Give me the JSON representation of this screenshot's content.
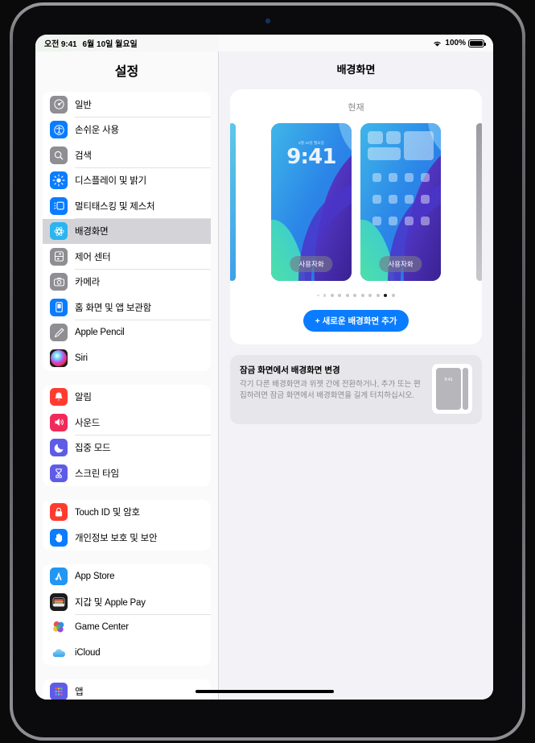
{
  "statusbar": {
    "time": "오전 9:41",
    "date": "6월 10일 월요일",
    "wifi_icon": "wifi-icon",
    "battery_pct": "100%",
    "battery_icon": "battery-icon"
  },
  "sidebar": {
    "title": "설정",
    "groups": [
      {
        "items": [
          {
            "label": "일반",
            "icon": "gear-icon",
            "color": "#8e8e93",
            "selected": false
          },
          {
            "label": "손쉬운 사용",
            "icon": "accessibility-icon",
            "color": "#0a7cff",
            "selected": false
          },
          {
            "label": "검색",
            "icon": "search-icon",
            "color": "#8e8e93",
            "selected": false
          },
          {
            "label": "디스플레이 및 밝기",
            "icon": "brightness-icon",
            "color": "#0a7cff",
            "selected": false
          },
          {
            "label": "멀티태스킹 및 제스처",
            "icon": "multitasking-icon",
            "color": "#0a7cff",
            "selected": false
          },
          {
            "label": "배경화면",
            "icon": "wallpaper-icon",
            "color": "#2bb5f0",
            "selected": true
          },
          {
            "label": "제어 센터",
            "icon": "control-center-icon",
            "color": "#8e8e93",
            "selected": false
          },
          {
            "label": "카메라",
            "icon": "camera-icon",
            "color": "#8e8e93",
            "selected": false
          },
          {
            "label": "홈 화면 및 앱 보관함",
            "icon": "home-screen-icon",
            "color": "#0a7cff",
            "selected": false
          },
          {
            "label": "Apple Pencil",
            "icon": "pencil-icon",
            "color": "#8e8e93",
            "selected": false
          },
          {
            "label": "Siri",
            "icon": "siri-icon",
            "color": "#1c1c1e",
            "selected": false
          }
        ]
      },
      {
        "items": [
          {
            "label": "알림",
            "icon": "bell-icon",
            "color": "#ff3b30",
            "selected": false
          },
          {
            "label": "사운드",
            "icon": "speaker-icon",
            "color": "#f02b5a",
            "selected": false
          },
          {
            "label": "집중 모드",
            "icon": "moon-icon",
            "color": "#5e5ce6",
            "selected": false
          },
          {
            "label": "스크린 타임",
            "icon": "hourglass-icon",
            "color": "#5e5ce6",
            "selected": false
          }
        ]
      },
      {
        "items": [
          {
            "label": "Touch ID 및 암호",
            "icon": "lock-icon",
            "color": "#ff3b30",
            "selected": false
          },
          {
            "label": "개인정보 보호 및 보안",
            "icon": "hand-icon",
            "color": "#0a7cff",
            "selected": false
          }
        ]
      },
      {
        "items": [
          {
            "label": "App Store",
            "icon": "app-store-icon",
            "color": "#2196f3",
            "selected": false
          },
          {
            "label": "지갑 및 Apple Pay",
            "icon": "wallet-icon",
            "color": "#1c1c1e",
            "selected": false
          },
          {
            "label": "Game Center",
            "icon": "game-center-icon",
            "color": "#ffffff",
            "selected": false
          },
          {
            "label": "iCloud",
            "icon": "icloud-icon",
            "color": "#ffffff",
            "selected": false
          }
        ]
      },
      {
        "items": [
          {
            "label": "앱",
            "icon": "apps-icon",
            "color": "#5e5ce6",
            "selected": false
          }
        ]
      }
    ]
  },
  "detail": {
    "title": "배경화면",
    "current_card": {
      "header": "현재",
      "lock_preview": {
        "name": "lock-screen-preview",
        "date": "6월 10일 월요일",
        "time": "9:41",
        "customize_label": "사용자화"
      },
      "home_preview": {
        "name": "home-screen-preview",
        "customize_label": "사용자화"
      },
      "dots_total": 11,
      "dots_active_index": 9,
      "add_button_label": "+ 새로운 배경화면 추가"
    },
    "info_card": {
      "title": "잠금 화면에서 배경화면 변경",
      "body": "각기 다른 배경화면과 위젯 간에 전환하거나, 추가 또는 편집하려면 잠금 화면에서 배경화면을 길게 터치하십시오.",
      "thumb_time": "9:41"
    }
  },
  "colors": {
    "accent": "#0a7cff",
    "screen_bg": "#f2f2f7",
    "card_bg": "#ffffff",
    "selected_row": "#d4d4d8"
  }
}
